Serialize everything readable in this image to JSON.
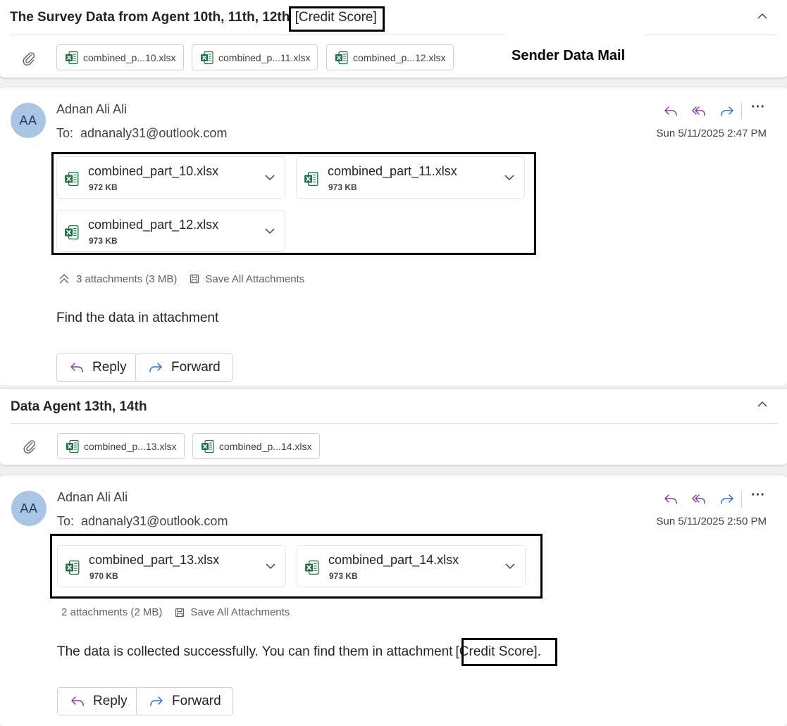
{
  "threads": [
    {
      "title": "The Survey Data from Agent 10th, 11th, 12th",
      "title_tag": "[Credit Score]",
      "chips": [
        "combined_p...10.xlsx",
        "combined_p...11.xlsx",
        "combined_p...12.xlsx"
      ],
      "message": {
        "avatar": "AA",
        "sender": "Adnan Ali Ali",
        "to_label": "To:",
        "to": "adnanaly31@outlook.com",
        "date": "Sun 5/11/2025 2:47 PM",
        "attachments": [
          {
            "name": "combined_part_10.xlsx",
            "size": "972 KB"
          },
          {
            "name": "combined_part_11.xlsx",
            "size": "973 KB"
          },
          {
            "name": "combined_part_12.xlsx",
            "size": "973 KB"
          }
        ],
        "summary": "3 attachments (3 MB)",
        "save_all": "Save All Attachments",
        "body": "Find the data in attachment",
        "reply": "Reply",
        "forward": "Forward"
      }
    },
    {
      "title": "Data Agent 13th, 14th",
      "chips": [
        "combined_p...13.xlsx",
        "combined_p...14.xlsx"
      ],
      "message": {
        "avatar": "AA",
        "sender": "Adnan Ali Ali",
        "to_label": "To:",
        "to": "adnanaly31@outlook.com",
        "date": "Sun 5/11/2025 2:50 PM",
        "attachments": [
          {
            "name": "combined_part_13.xlsx",
            "size": "970 KB"
          },
          {
            "name": "combined_part_14.xlsx",
            "size": "973 KB"
          }
        ],
        "summary": "2 attachments (2 MB)",
        "save_all": "Save All Attachments",
        "body": "The data is collected successfully. You can find them in attachment",
        "body_tag": "[Credit Score]",
        "body_end": ".",
        "reply": "Reply",
        "forward": "Forward"
      }
    }
  ],
  "annotation": "Sender Data Mail",
  "colors": {
    "accent_purple": "#8b3e9c",
    "accent_blue": "#2f6fd0",
    "excel_green": "#1e7145",
    "avatar_bg": "#a9c5e3"
  },
  "icons": [
    "paperclip-icon",
    "excel-file-icon",
    "chevron-up-icon",
    "chevron-down-icon",
    "reply-icon",
    "reply-all-icon",
    "forward-icon",
    "more-icon",
    "save-icon",
    "collapse-icon"
  ]
}
